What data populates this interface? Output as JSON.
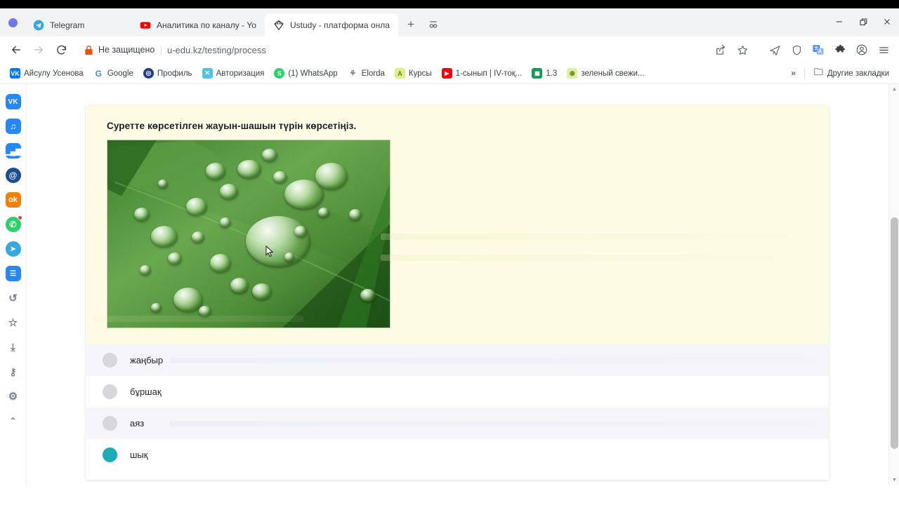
{
  "window": {
    "controls": {
      "minimize": "—",
      "maximize": "❐",
      "close": "✕"
    }
  },
  "tabs": [
    {
      "title": "Telegram",
      "favicon": "telegram-icon",
      "active": false
    },
    {
      "title": "Аналитика по каналу - YouTu",
      "favicon": "youtube-icon",
      "active": false
    },
    {
      "title": "Ustudy - платформа онлайн",
      "favicon": "ustudy-diamond-icon",
      "active": true
    }
  ],
  "tabstrip": {
    "new_tab_label": "+",
    "tab_search_label": "tab-search-icon",
    "profile_dot": "vk-profile-dot"
  },
  "toolbar": {
    "back": "back-arrow-icon",
    "forward": "forward-arrow-icon",
    "reload": "reload-icon",
    "security_label": "Не защищено",
    "separator": "|",
    "url": "u-edu.kz/testing/process",
    "icons": [
      "share-icon",
      "bookmark-star-icon",
      "send-to-devices-icon",
      "shield-icon",
      "translate-icon",
      "extensions-puzzle-icon",
      "profile-avatar-icon",
      "menu-kebab-icon"
    ]
  },
  "bookmarks": {
    "items": [
      {
        "label": "Айсулу Усенова",
        "icon": "vk-icon",
        "color": "#0077ff",
        "glyph": "VK"
      },
      {
        "label": "Google",
        "icon": "google-icon",
        "color": "#ffffff",
        "glyph": "G"
      },
      {
        "label": "Профиль",
        "icon": "profile-circle-icon",
        "color": "#1b3c8c",
        "glyph": "◉"
      },
      {
        "label": "Авторизация",
        "icon": "auth-icon",
        "color": "#35b6e8",
        "glyph": "☒"
      },
      {
        "label": "(1) WhatsApp",
        "icon": "whatsapp-icon",
        "color": "#25d366",
        "glyph": "S"
      },
      {
        "label": "Elorda",
        "icon": "elorda-icon",
        "color": "#ffffff",
        "glyph": "⚘"
      },
      {
        "label": "Курсы",
        "icon": "courses-icon",
        "color": "#d9e36a",
        "glyph": "A"
      },
      {
        "label": "1-сынып | IV-тоқ...",
        "icon": "youtube-icon",
        "color": "#ff0000",
        "glyph": "▶"
      },
      {
        "label": "1.3",
        "icon": "sheet-icon",
        "color": "#0f9d58",
        "glyph": "▦"
      },
      {
        "label": "зеленый свежи...",
        "icon": "image-icon",
        "color": "#d6e98a",
        "glyph": "◉"
      }
    ],
    "overflow_label": "»",
    "other_bookmarks_label": "Другие закладки",
    "other_bookmarks_icon": "folder-icon"
  },
  "sidepanel": {
    "items": [
      {
        "name": "vk-icon",
        "glyph": "VK",
        "color": "#2787f5",
        "badge": false
      },
      {
        "name": "music-icon",
        "glyph": "♫",
        "color": "#2787f5",
        "badge": false
      },
      {
        "name": "stats-icon",
        "glyph": "▮▮",
        "color": "#2787f5",
        "badge": false
      },
      {
        "name": "mail-icon",
        "glyph": "@",
        "color": "#1b4d94",
        "badge": false
      },
      {
        "name": "odnoklassniki-icon",
        "glyph": "ok",
        "color": "#ee8208",
        "badge": false
      },
      {
        "name": "whatsapp-icon",
        "glyph": "✆",
        "color": "#25d366",
        "badge": true
      },
      {
        "name": "telegram-icon",
        "glyph": "➤",
        "color": "#34a9e0",
        "badge": false
      },
      {
        "name": "tasks-icon",
        "glyph": "☰",
        "color": "#2787f5",
        "badge": false
      },
      {
        "name": "history-icon",
        "glyph": "↺",
        "color": "",
        "badge": false
      },
      {
        "name": "favorites-star-icon",
        "glyph": "☆",
        "color": "",
        "badge": false
      },
      {
        "name": "downloads-icon",
        "glyph": "⤓",
        "color": "",
        "badge": false
      },
      {
        "name": "key-icon",
        "glyph": "⚷",
        "color": "",
        "badge": false
      },
      {
        "name": "settings-gear-icon",
        "glyph": "⚙",
        "color": "",
        "badge": false
      },
      {
        "name": "collapse-chevron-icon",
        "glyph": "⌃",
        "color": "",
        "badge": false
      }
    ]
  },
  "quiz": {
    "question": "Суретте көрсетілген жауын-шашын түрін көрсетіңіз.",
    "image_alt": "dew-drops-on-green-leaf",
    "options": [
      {
        "label": "жаңбыр",
        "selected": false
      },
      {
        "label": "бұршақ",
        "selected": false
      },
      {
        "label": "аяз",
        "selected": false
      },
      {
        "label": "шық",
        "selected": true
      }
    ],
    "selected_color": "#1cacb6",
    "unselected_color": "#d6d6db",
    "question_block_color": "#fdfbe4"
  },
  "scrollbar": {
    "up_arrow": "▲",
    "down_arrow": "▼"
  }
}
